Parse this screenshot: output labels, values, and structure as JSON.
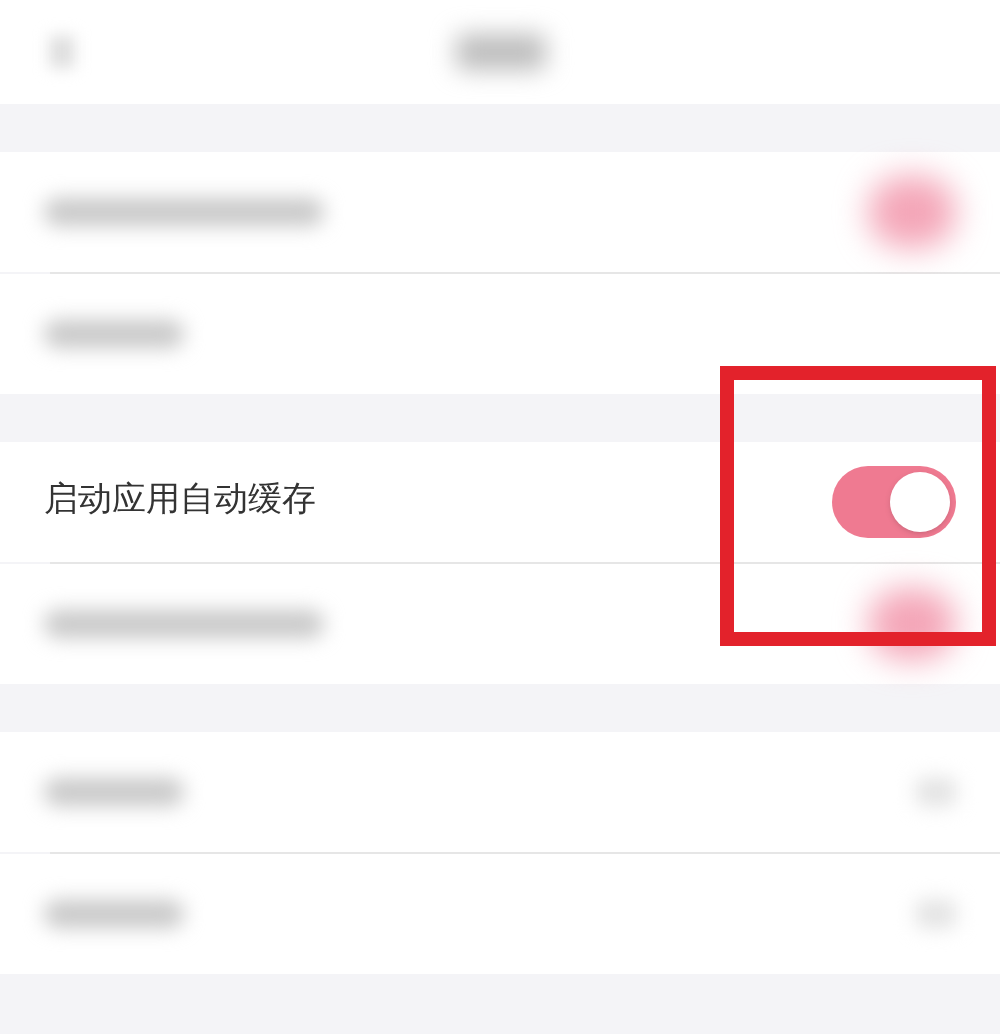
{
  "sections": [
    {
      "rows": [
        {
          "kind": "blurred_toggle"
        },
        {
          "kind": "blurred_text"
        }
      ]
    },
    {
      "rows": [
        {
          "kind": "toggle",
          "label": "启动应用自动缓存",
          "on": true,
          "highlighted": true
        },
        {
          "kind": "blurred_toggle"
        }
      ]
    },
    {
      "rows": [
        {
          "kind": "blurred_chevron"
        },
        {
          "kind": "blurred_chevron"
        }
      ]
    }
  ]
}
